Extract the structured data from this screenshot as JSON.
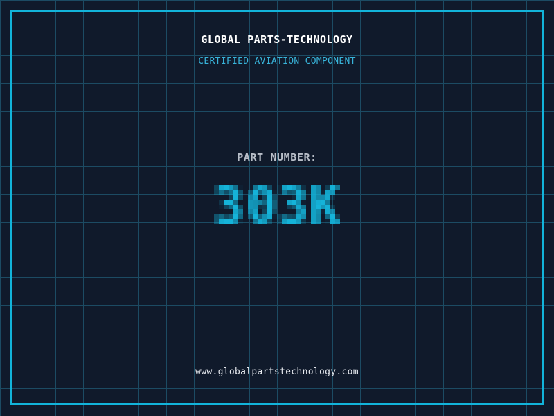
{
  "header": {
    "title": "GLOBAL PARTS-TECHNOLOGY",
    "subtitle": "CERTIFIED AVIATION COMPONENT"
  },
  "part": {
    "label": "PART NUMBER:",
    "value": "303K"
  },
  "footer": {
    "url": "www.globalpartstechnology.com"
  },
  "colors": {
    "background": "#101a2b",
    "grid_line": "#1c4b63",
    "frame": "#12b4da",
    "title_text": "#ffffff",
    "subtitle_text": "#38b4da",
    "part_label_text": "#b8bec8",
    "part_value_text": "#15b3d9",
    "footer_text": "#e6e9ee"
  }
}
